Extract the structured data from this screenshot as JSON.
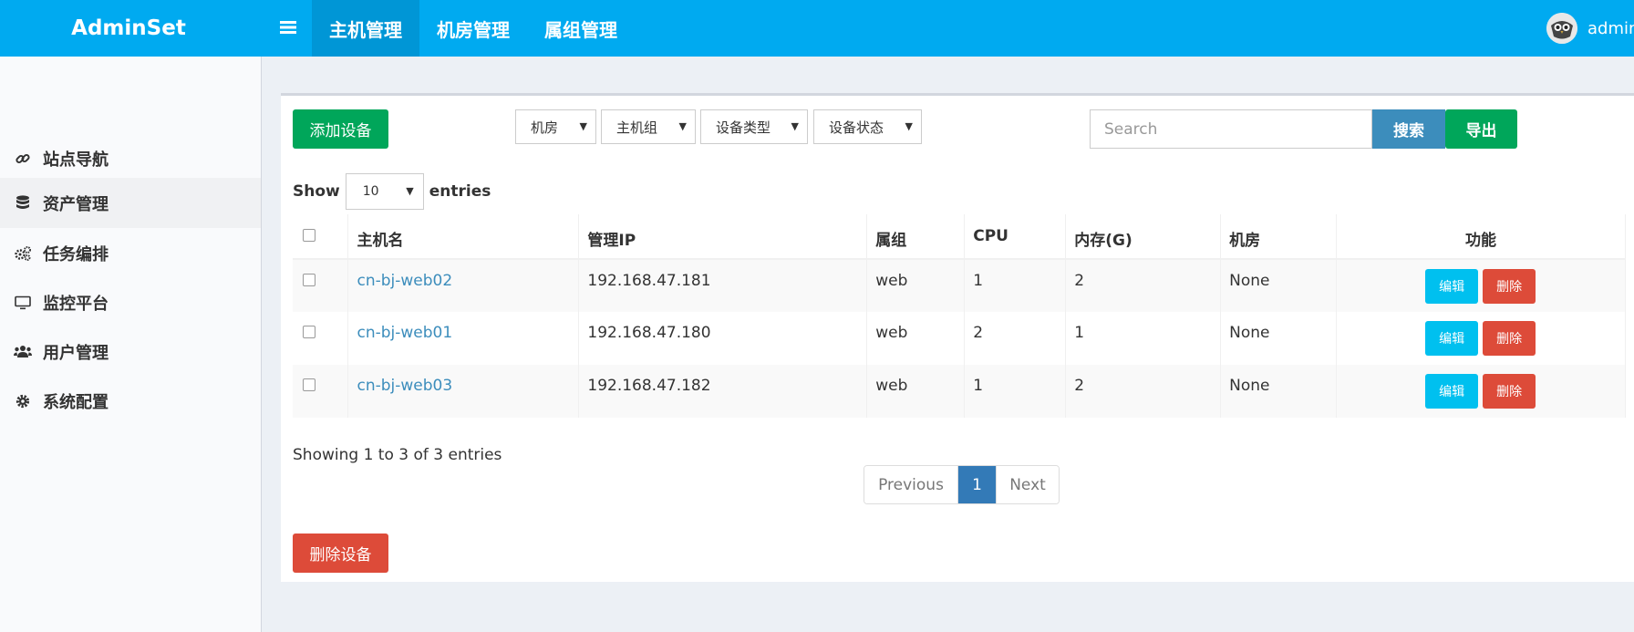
{
  "app": {
    "brand": "AdminSet"
  },
  "topnav": {
    "menu_icon": "bars-icon",
    "items": [
      {
        "label": "主机管理",
        "active": true
      },
      {
        "label": "机房管理",
        "active": false
      },
      {
        "label": "属组管理",
        "active": false
      }
    ],
    "user": {
      "name": "admin",
      "avatar_icon": "owl-avatar-icon"
    }
  },
  "sidebar": {
    "items": [
      {
        "label": "站点导航",
        "icon": "link-icon",
        "active": false
      },
      {
        "label": "资产管理",
        "icon": "database-icon",
        "active": true
      },
      {
        "label": "任务编排",
        "icon": "cogs-icon",
        "active": false
      },
      {
        "label": "监控平台",
        "icon": "desktop-icon",
        "active": false
      },
      {
        "label": "用户管理",
        "icon": "users-icon",
        "active": false
      },
      {
        "label": "系统配置",
        "icon": "gear-icon",
        "active": false
      }
    ]
  },
  "toolbar": {
    "add_label": "添加设备",
    "filters": [
      "机房",
      "主机组",
      "设备类型",
      "设备状态"
    ],
    "search_placeholder": "Search",
    "search_label": "搜索",
    "export_label": "导出"
  },
  "length_menu": {
    "show": "Show",
    "value": "10",
    "entries": "entries"
  },
  "table": {
    "columns": [
      "主机名",
      "管理IP",
      "属组",
      "CPU",
      "内存(G)",
      "机房",
      "功能"
    ],
    "rows": [
      {
        "hostname": "cn-bj-web02",
        "ip": "192.168.47.181",
        "group": "web",
        "cpu": "1",
        "mem": "2",
        "idc": "None"
      },
      {
        "hostname": "cn-bj-web01",
        "ip": "192.168.47.180",
        "group": "web",
        "cpu": "2",
        "mem": "1",
        "idc": "None"
      },
      {
        "hostname": "cn-bj-web03",
        "ip": "192.168.47.182",
        "group": "web",
        "cpu": "1",
        "mem": "2",
        "idc": "None"
      }
    ],
    "edit_label": "编辑",
    "delete_label": "删除"
  },
  "footer": {
    "info": "Showing 1 to 3 of 3 entries",
    "previous": "Previous",
    "current_page": "1",
    "next": "Next",
    "delete_devices_label": "删除设备"
  },
  "colors": {
    "topbar": "#00aaf0",
    "green": "#00a65a",
    "red": "#dd4b39",
    "blue": "#3c8dbc",
    "cyan": "#00c0ef"
  }
}
